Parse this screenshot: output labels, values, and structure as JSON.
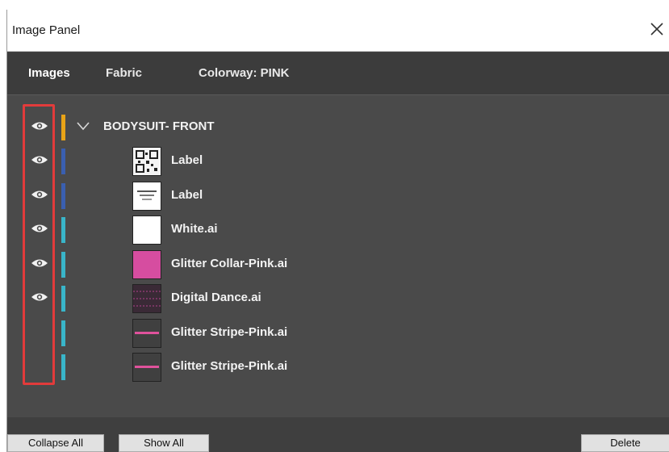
{
  "window": {
    "title": "Image Panel",
    "close_glyph": "✕"
  },
  "tabs": [
    {
      "label": "Images",
      "active": true
    },
    {
      "label": "Fabric",
      "active": false
    },
    {
      "label": "Colorway: PINK",
      "active": false
    }
  ],
  "group": {
    "label": "BODYSUIT- FRONT",
    "expanded": true,
    "color": "#e8a317",
    "visible": true
  },
  "layers": [
    {
      "label": "Label",
      "visible": true,
      "color": "#3a5fb0",
      "thumb": "qr"
    },
    {
      "label": "Label",
      "visible": true,
      "color": "#3a5fb0",
      "thumb": "label"
    },
    {
      "label": "White.ai",
      "visible": true,
      "color": "#39b5c9",
      "thumb": "white"
    },
    {
      "label": "Glitter Collar-Pink.ai",
      "visible": true,
      "color": "#39b5c9",
      "thumb": "pink"
    },
    {
      "label": "Digital Dance.ai",
      "visible": true,
      "color": "#39b5c9",
      "thumb": "pattern"
    },
    {
      "label": "Glitter Stripe-Pink.ai",
      "visible": false,
      "color": "#39b5c9",
      "thumb": "stripe"
    },
    {
      "label": "Glitter Stripe-Pink.ai",
      "visible": false,
      "color": "#39b5c9",
      "thumb": "stripe"
    }
  ],
  "footer": {
    "collapse_all": "Collapse All",
    "show_all": "Show All",
    "delete": "Delete"
  },
  "colors": {
    "highlight": "#e23b3b",
    "panel_bg": "#4a4a4a",
    "tab_bg": "#3c3c3c"
  }
}
